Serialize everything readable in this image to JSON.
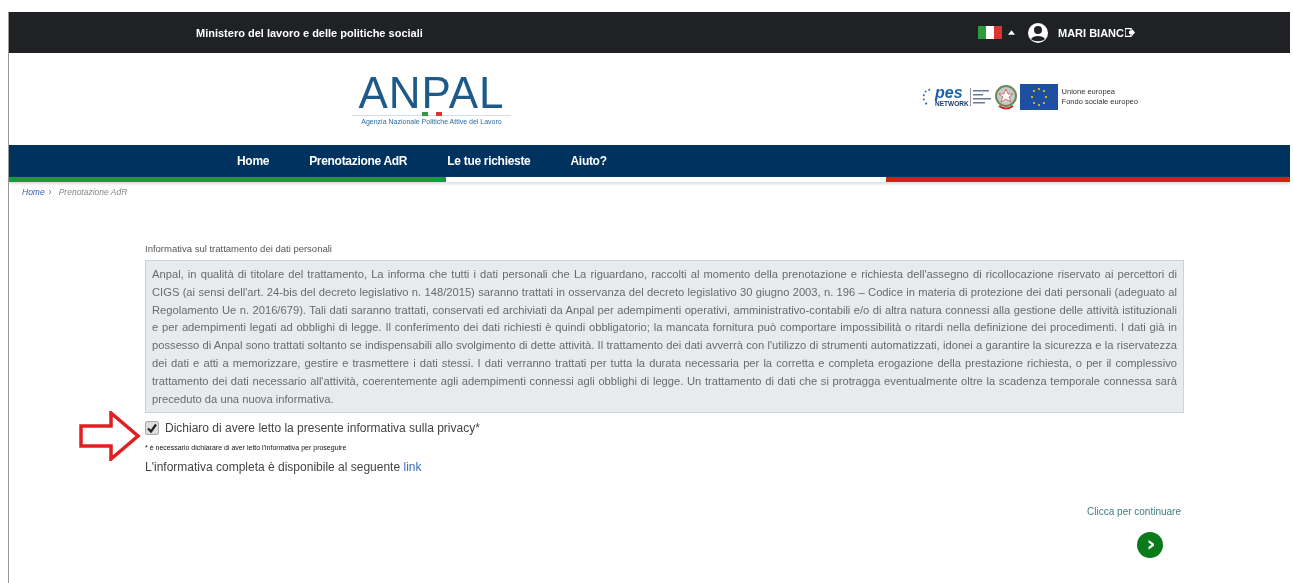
{
  "top_bar": {
    "ministry": "Ministero del lavoro e delle politiche sociali",
    "user_name": "MARI BIANC"
  },
  "header": {
    "logo_text": "ANPAL",
    "logo_subtitle": "Agenzia Nazionale Politiche Attive del Lavoro",
    "pes_text": "pes",
    "pes_network": "NETWORK",
    "eu_text": [
      "Unione europea",
      "Fondo sociale europeo"
    ]
  },
  "nav": {
    "items": [
      {
        "label": "Home",
        "selected": false
      },
      {
        "label": "Prenotazione AdR",
        "selected": false
      },
      {
        "label": "Le tue richieste",
        "selected": false
      },
      {
        "label": "Aiuto?",
        "selected": false
      }
    ]
  },
  "breadcrumb": [
    {
      "label": "Home",
      "kind": "link"
    },
    {
      "label": "Prenotazione AdR",
      "kind": "current"
    }
  ],
  "privacy": {
    "heading": "Informativa sul trattamento dei dati personali",
    "body": "Anpal, in qualità di titolare del trattamento, La informa che tutti i dati personali che La riguardano, raccolti al momento della prenotazione e richiesta dell'assegno di ricollocazione riservato ai percettori di CIGS (ai sensi dell'art. 24-bis del decreto legislativo n. 148/2015) saranno trattati in osservanza del decreto legislativo 30 giugno 2003, n. 196 – Codice in materia di protezione dei dati personali (adeguato al Regolamento Ue n. 2016/679). Tali dati saranno trattati, conservati ed archiviati da Anpal per adempimenti operativi, amministrativo-contabili e/o di altra natura connessi alla gestione delle attività istituzionali e per adempimenti legati ad obblighi di legge. Il conferimento dei dati richiesti è quindi obbligatorio; la mancata fornitura può comportare impossibilità o ritardi nella definizione dei procedimenti. I dati già in possesso di Anpal sono trattati soltanto se indispensabili allo svolgimento di dette attività. Il trattamento dei dati avverrà con l'utilizzo di strumenti automatizzati, idonei a garantire la sicurezza e la riservatezza dei dati e atti a memorizzare, gestire e trasmettere i dati stessi. I dati verranno trattati per tutta la durata necessaria per la corretta e completa erogazione della prestazione richiesta, o per il complessivo trattamento dei dati necessario all'attività, coerentemente agli adempimenti connessi agli obblighi di legge. Un trattamento di dati che si protragga eventualmente oltre la scadenza temporale connessa sarà preceduto da una nuova informativa.",
    "consent": {
      "label": "Dichiaro di avere letto la presente informativa sulla privacy*",
      "checked": true
    },
    "note": "* è necessario dichiarare di aver letto l'informativa per proseguire",
    "full_text": "L'informativa completa è disponibile al seguente",
    "link": "link"
  },
  "continue": {
    "label": "Clicca per continuare",
    "button": "›"
  }
}
